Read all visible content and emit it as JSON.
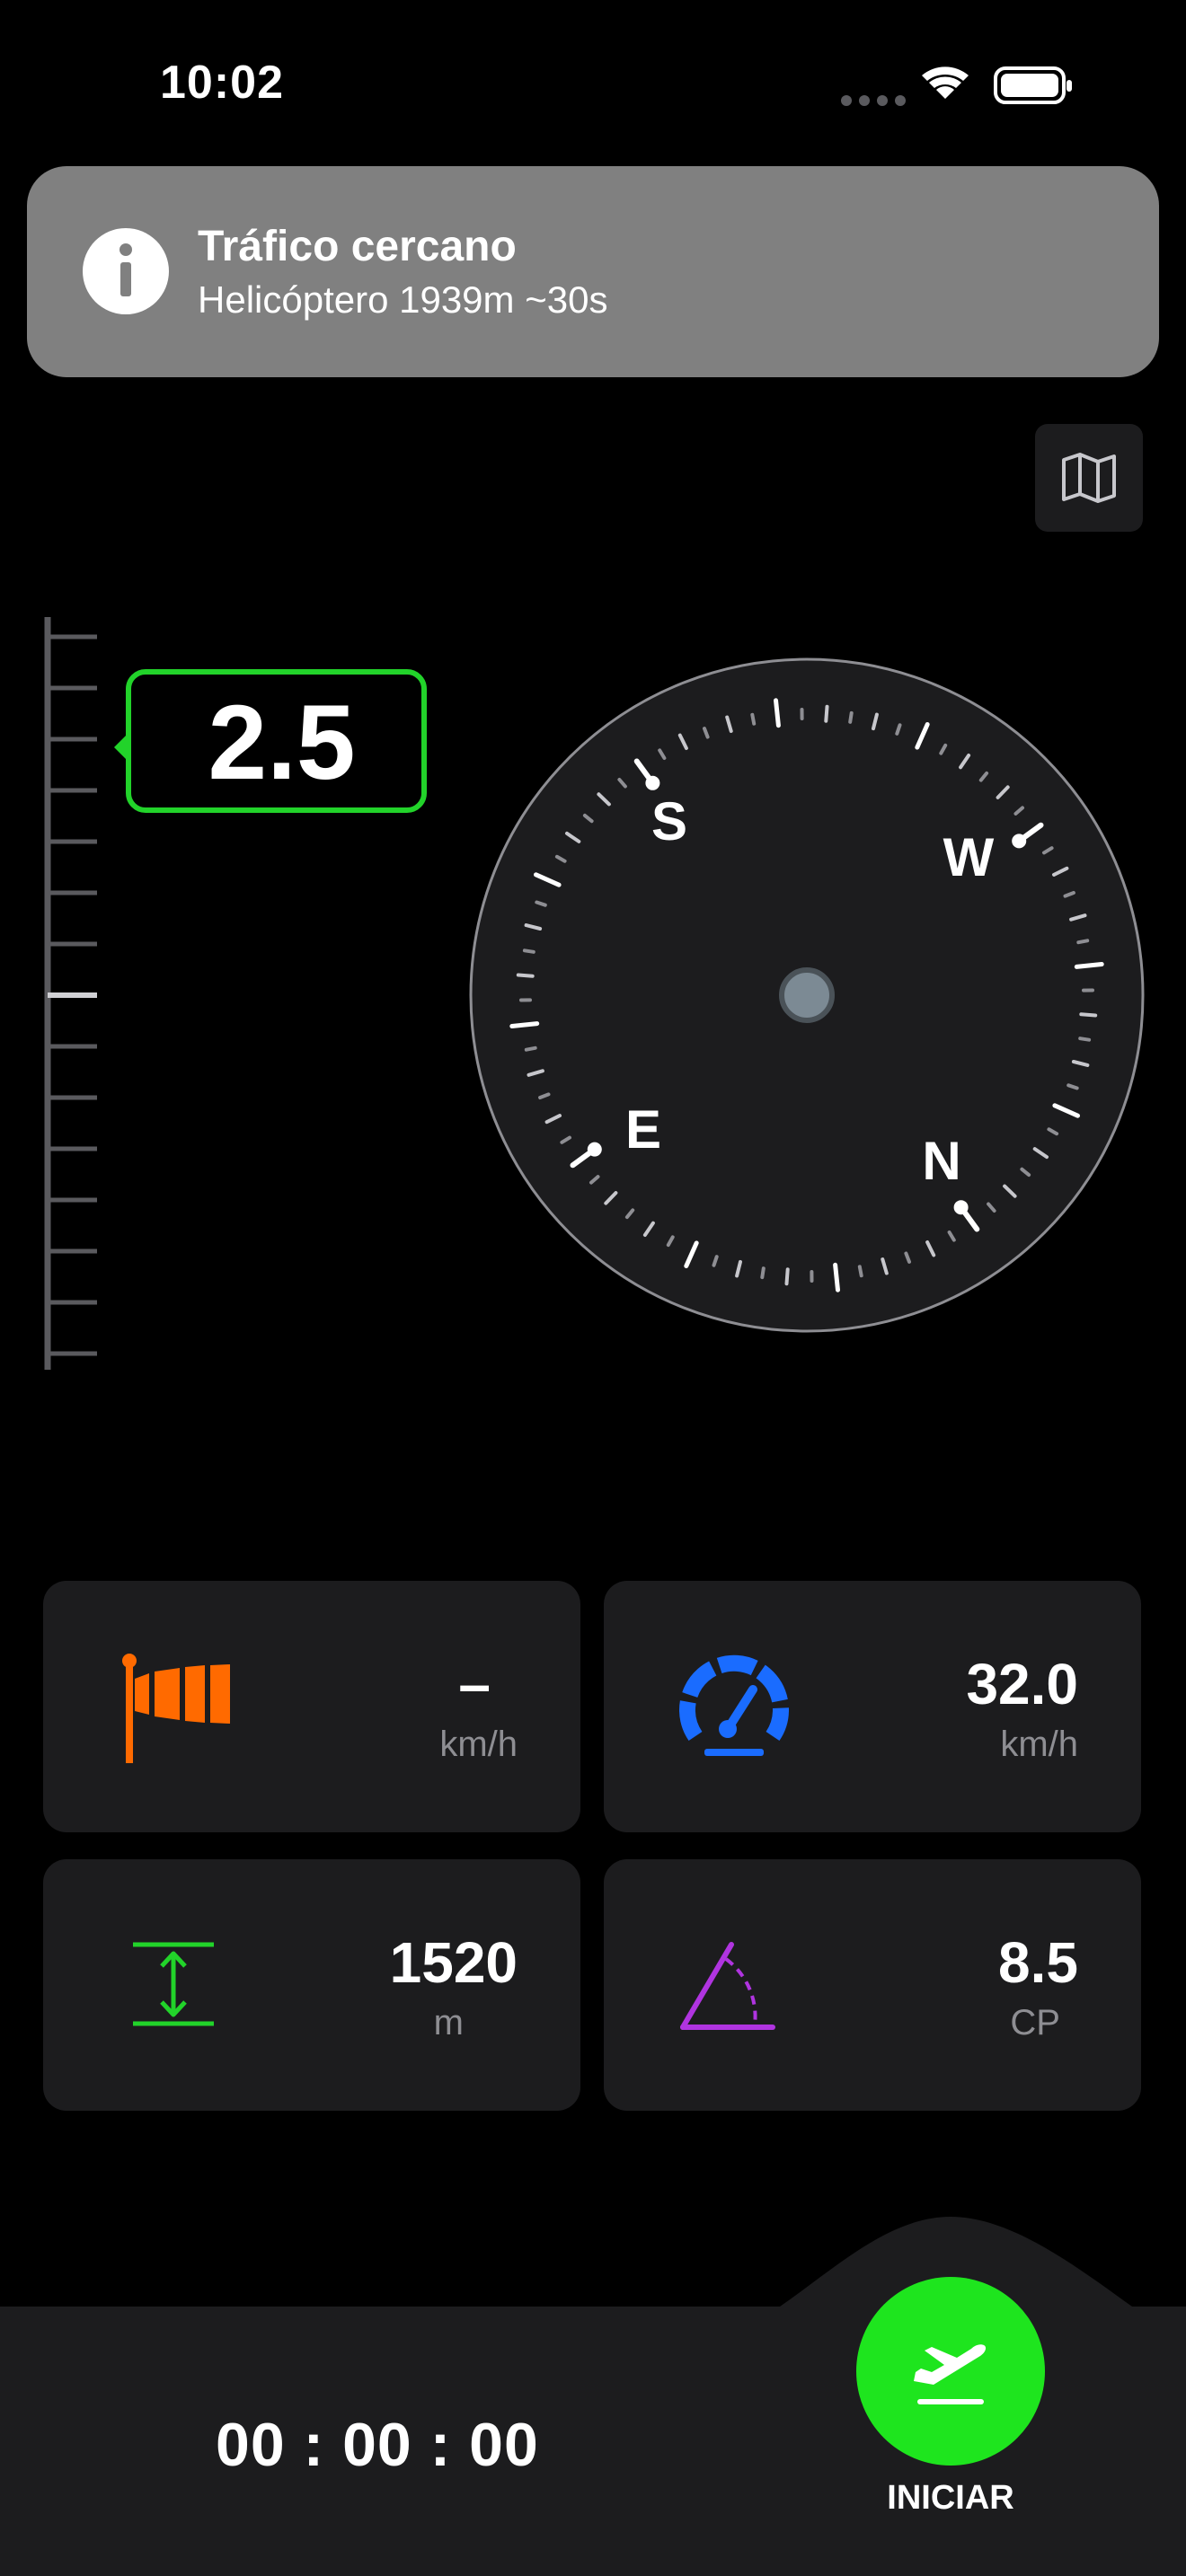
{
  "status_bar": {
    "time": "10:02",
    "icons": [
      "signal-dots-icon",
      "wifi-icon",
      "battery-icon"
    ]
  },
  "notification": {
    "icon": "info-icon",
    "title": "Tráfico cercano",
    "subtitle": "Helicóptero 1939m ~30s",
    "background_color": "#808080"
  },
  "map_button": {
    "icon": "map-icon"
  },
  "vario": {
    "value": "2.5",
    "border_color": "#22d32a"
  },
  "compass": {
    "cardinals": {
      "north": "N",
      "east": "E",
      "south": "S",
      "west": "W"
    }
  },
  "cards": {
    "wind": {
      "icon": "windsock-icon",
      "value": "–",
      "unit": "km/h",
      "color": "#ff6a00"
    },
    "speed": {
      "icon": "speedometer-icon",
      "value": "32.0",
      "unit": "km/h",
      "color": "#1a6cff"
    },
    "altitude": {
      "icon": "vertical-arrows-icon",
      "value": "1520",
      "unit": "m",
      "color": "#22d32a"
    },
    "glide": {
      "icon": "angle-icon",
      "value": "8.5",
      "unit": "CP",
      "color": "#b034e0"
    }
  },
  "bottom_bar": {
    "timer": "00 : 00 : 00",
    "start_label": "INICIAR",
    "start_icon": "takeoff-icon",
    "start_color": "#1ee51e"
  }
}
